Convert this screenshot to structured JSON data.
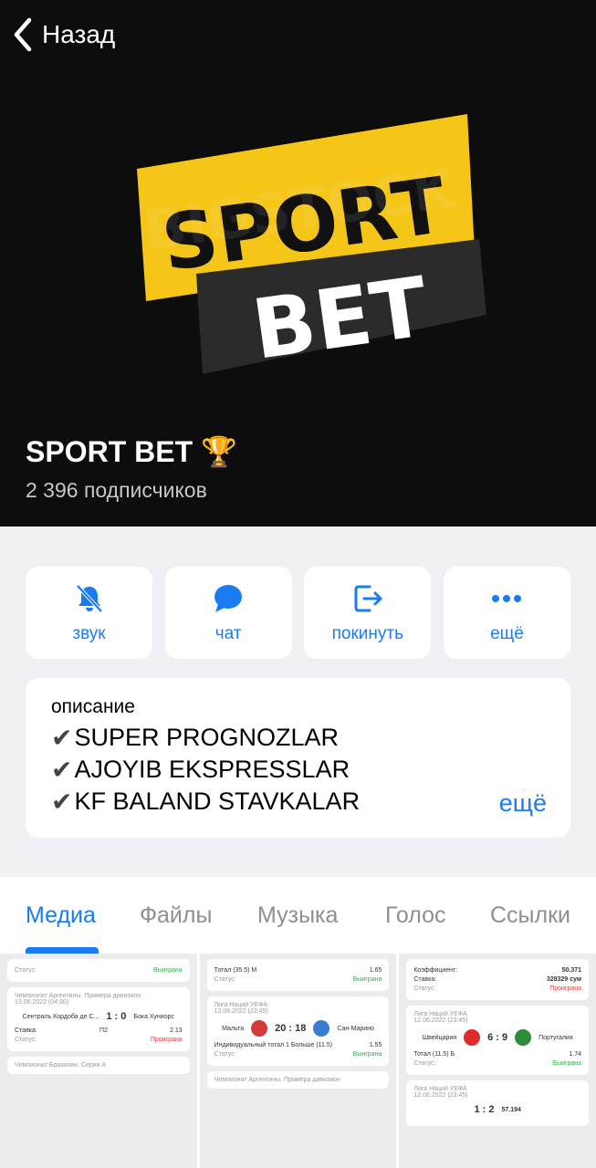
{
  "nav": {
    "back_label": "Назад"
  },
  "logo": {
    "word1": "SPORT",
    "word2": "BET",
    "watermark": "BIGSTOCK",
    "accent": "#f5c518"
  },
  "channel": {
    "title": "SPORT BET 🏆",
    "subscribers": "2 396 подписчиков"
  },
  "actions": [
    {
      "label": "звук",
      "icon": "bell-off-icon"
    },
    {
      "label": "чат",
      "icon": "chat-bubble-icon"
    },
    {
      "label": "покинуть",
      "icon": "leave-icon"
    },
    {
      "label": "ещё",
      "icon": "more-dots-icon"
    }
  ],
  "description": {
    "label": "описание",
    "lines": [
      "SUPER PROGNOZLAR",
      "AJOYIB EKSPRESSLAR",
      "KF BALAND STAVKALAR"
    ],
    "more": "ещё"
  },
  "tabs": [
    "Медиа",
    "Файлы",
    "Музыка",
    "Голос",
    "Ссылки"
  ],
  "media": {
    "tile1": {
      "status_a": "Выиграна",
      "league": "Чемпионат Аргентины. Примера дивизион",
      "date": "13.06.2022 (04:30)",
      "team1": "Сентраль Кордоба де С...",
      "score": "1 : 0",
      "team2": "Бока Хуниорс",
      "stake_label": "Ставка:",
      "stake": "П2",
      "odd": "2.13",
      "status_b": "Проиграна",
      "league2": "Чемпионат Бразилии. Серия А"
    },
    "tile2": {
      "stake": "Тотал (35.5) М",
      "odd": "1.65",
      "status_a": "Выиграна",
      "league": "Лига Наций УЕФА",
      "date": "12.06.2022 (22:45)",
      "team1": "Мальта",
      "score": "20 : 18",
      "team2": "Сан-Марино",
      "stake2": "Индивидуальный тотал 1 Больше (11.5)",
      "odd2": "1.55",
      "status_b": "Выиграна",
      "league2": "Чемпионат Аргентины. Примера дивизион"
    },
    "tile3": {
      "coef_label": "Коэффициент:",
      "coef": "50.371",
      "stake_label": "Ставка:",
      "stake": "328329 сум",
      "status": "Проиграна",
      "league": "Лига Наций УЕФА",
      "date": "12.06.2022 (23:45)",
      "team1": "Швейцария",
      "score": "6 : 9",
      "team2": "Португалия",
      "stake2": "Тотал (11.5) Б",
      "odd2": "1.74",
      "status_b": "Выиграна",
      "league2": "Лига Наций УЕФА",
      "date2": "12.06.2022 (23:45)",
      "score2": "1 : 2",
      "coef2": "57.194"
    }
  }
}
